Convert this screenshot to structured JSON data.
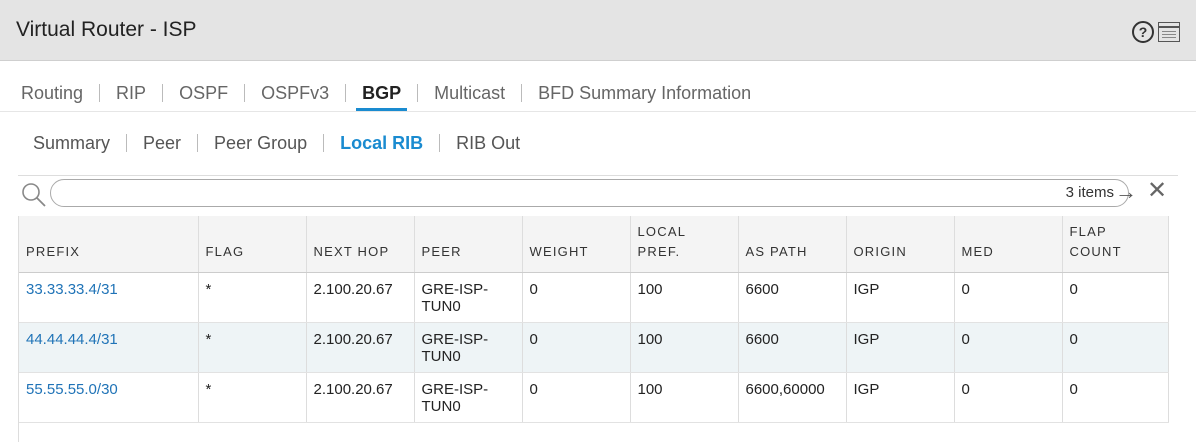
{
  "window": {
    "title": "Virtual Router - ISP",
    "help_glyph": "?",
    "accent_color": "#1a8bd0"
  },
  "main_tabs": [
    {
      "label": "Routing",
      "active": false
    },
    {
      "label": "RIP",
      "active": false
    },
    {
      "label": "OSPF",
      "active": false
    },
    {
      "label": "OSPFv3",
      "active": false
    },
    {
      "label": "BGP",
      "active": true
    },
    {
      "label": "Multicast",
      "active": false
    },
    {
      "label": "BFD Summary Information",
      "active": false
    }
  ],
  "sub_tabs": [
    {
      "label": "Summary",
      "active": false
    },
    {
      "label": "Peer",
      "active": false
    },
    {
      "label": "Peer Group",
      "active": false
    },
    {
      "label": "Local RIB",
      "active": true
    },
    {
      "label": "RIB Out",
      "active": false
    }
  ],
  "search": {
    "value": "",
    "placeholder": "",
    "items_count": "3 items",
    "apply_glyph": "→",
    "clear_glyph": "✕"
  },
  "table": {
    "columns": [
      "PREFIX",
      "FLAG",
      "NEXT HOP",
      "PEER",
      "WEIGHT",
      "LOCAL PREF.",
      "AS PATH",
      "ORIGIN",
      "MED",
      "FLAP COUNT"
    ],
    "rows": [
      [
        "33.33.33.4/31",
        "*",
        "2.100.20.67",
        "GRE-ISP-TUN0",
        "0",
        "100",
        "6600",
        "IGP",
        "0",
        "0"
      ],
      [
        "44.44.44.4/31",
        "*",
        "2.100.20.67",
        "GRE-ISP-TUN0",
        "0",
        "100",
        "6600",
        "IGP",
        "0",
        "0"
      ],
      [
        "55.55.55.0/30",
        "*",
        "2.100.20.67",
        "GRE-ISP-TUN0",
        "0",
        "100",
        "6600,60000",
        "IGP",
        "0",
        "0"
      ]
    ]
  }
}
